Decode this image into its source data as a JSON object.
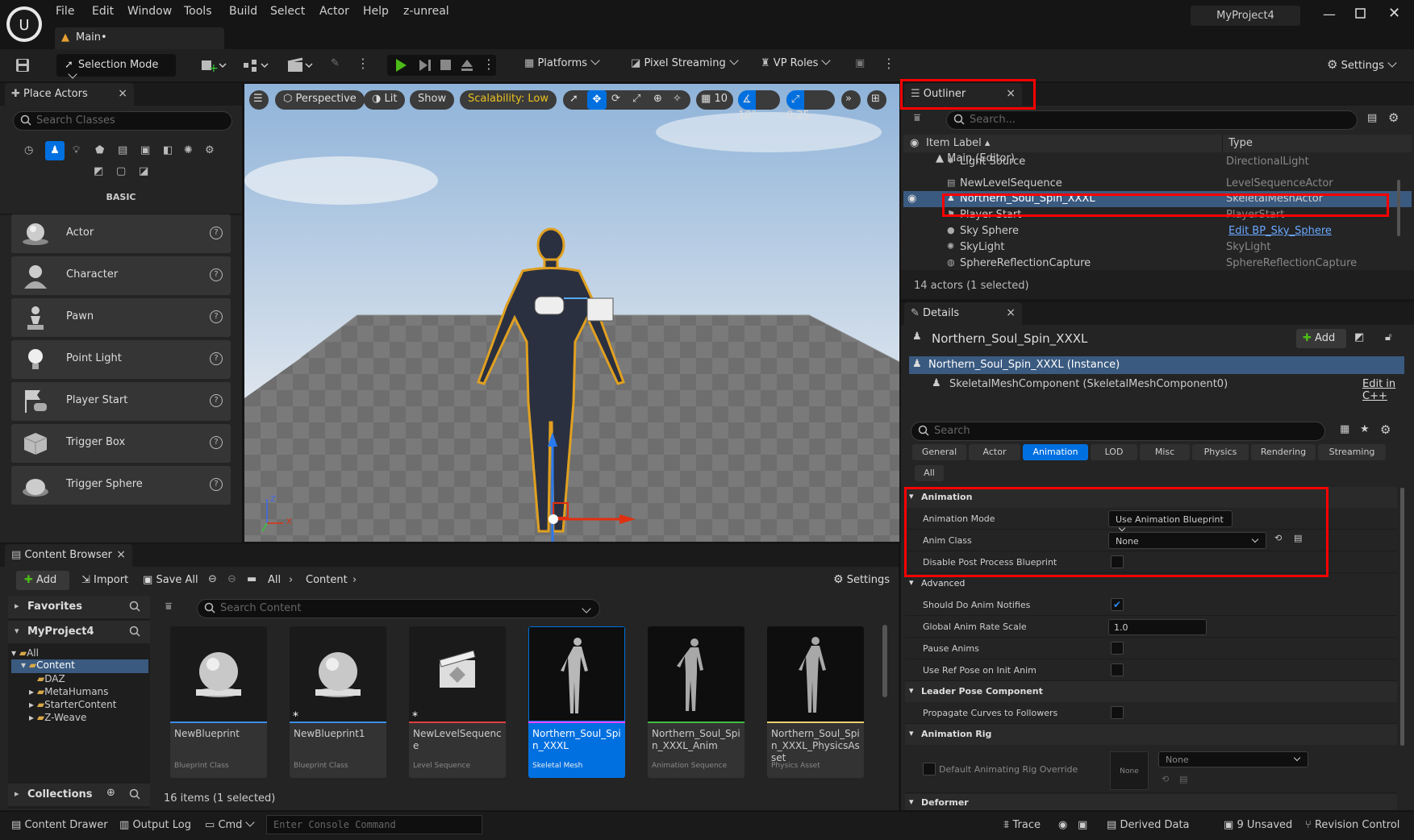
{
  "menu": [
    "File",
    "Edit",
    "Window",
    "Tools",
    "Build",
    "Select",
    "Actor",
    "Help",
    "z-unreal"
  ],
  "level_tab": "Main•",
  "project_name": "MyProject4",
  "toolbar": {
    "selection_mode": "Selection Mode",
    "platforms": "Platforms",
    "pixel_streaming": "Pixel Streaming",
    "vp_roles": "VP Roles",
    "settings": "Settings"
  },
  "place_actors": {
    "title": "Place Actors",
    "search_placeholder": "Search Classes",
    "category": "BASIC",
    "items": [
      "Actor",
      "Character",
      "Pawn",
      "Point Light",
      "Player Start",
      "Trigger Box",
      "Trigger Sphere"
    ]
  },
  "viewport": {
    "perspective": "Perspective",
    "lit": "Lit",
    "show": "Show",
    "scalability": "Scalability: Low",
    "grid": "10",
    "angle": "10°",
    "scale": "0.25",
    "axis_z": "Z",
    "axis_x": "X"
  },
  "outliner": {
    "title": "Outliner",
    "search_placeholder": "Search...",
    "col_label": "Item Label",
    "col_type": "Type",
    "root": "Main (Editor)",
    "rows": [
      {
        "name": "Light Source",
        "type": "DirectionalLight"
      },
      {
        "name": "NewLevelSequence",
        "type": "LevelSequenceActor"
      },
      {
        "name": "Northern_Soul_Spin_XXXL",
        "type": "SkeletalMeshActor"
      },
      {
        "name": "Player Start",
        "type": "PlayerStart"
      },
      {
        "name": "Sky Sphere",
        "type": "Edit BP_Sky_Sphere"
      },
      {
        "name": "SkyLight",
        "type": "SkyLight"
      },
      {
        "name": "SphereReflectionCapture",
        "type": "SphereReflectionCapture"
      }
    ],
    "status": "14 actors (1 selected)"
  },
  "details": {
    "title": "Details",
    "actor_name": "Northern_Soul_Spin_XXXL",
    "add": "Add",
    "instance": "Northern_Soul_Spin_XXXL (Instance)",
    "component": "SkeletalMeshComponent (SkeletalMeshComponent0)",
    "edit_cpp": "Edit in C++",
    "search_placeholder": "Search",
    "tabs": [
      "General",
      "Actor",
      "Animation",
      "LOD",
      "Misc",
      "Physics",
      "Rendering",
      "Streaming",
      "All"
    ],
    "sec_animation": "Animation",
    "anim_mode_label": "Animation Mode",
    "anim_mode_value": "Use Animation Blueprint",
    "anim_class_label": "Anim Class",
    "anim_class_value": "None",
    "disable_pp_label": "Disable Post Process Blueprint",
    "sec_advanced": "Advanced",
    "anim_notifies_label": "Should Do Anim Notifies",
    "rate_scale_label": "Global Anim Rate Scale",
    "rate_scale_value": "1.0",
    "pause_label": "Pause Anims",
    "ref_pose_label": "Use Ref Pose on Init Anim",
    "sec_leader": "Leader Pose Component",
    "propagate_label": "Propagate Curves to Followers",
    "sec_rig": "Animation Rig",
    "rig_override_label": "Default Animating Rig Override",
    "rig_thumb": "None",
    "rig_value": "None",
    "sec_deformer": "Deformer"
  },
  "content_browser": {
    "title": "Content Browser",
    "add": "Add",
    "import": "Import",
    "save_all": "Save All",
    "crumb_all": "All",
    "crumb_content": "Content",
    "settings": "Settings",
    "favorites": "Favorites",
    "project": "MyProject4",
    "search_placeholder": "Search Content",
    "tree": [
      "All",
      "Content",
      "DAZ",
      "MetaHumans",
      "StarterContent",
      "Z-Weave"
    ],
    "collections": "Collections",
    "status": "16 items (1 selected)",
    "assets": [
      {
        "name": "NewBlueprint",
        "type": "Blueprint Class"
      },
      {
        "name": "NewBlueprint1",
        "type": "Blueprint Class"
      },
      {
        "name": "NewLevelSequence",
        "type": "Level Sequence"
      },
      {
        "name": "Northern_Soul_Spin_XXXL",
        "type": "Skeletal Mesh"
      },
      {
        "name": "Northern_Soul_Spin_XXXL_Anim",
        "type": "Animation Sequence"
      },
      {
        "name": "Northern_Soul_Spin_XXXL_PhysicsAsset",
        "type": "Physics Asset"
      }
    ]
  },
  "statusbar": {
    "content_drawer": "Content Drawer",
    "output_log": "Output Log",
    "cmd": "Cmd",
    "console_placeholder": "Enter Console Command",
    "trace": "Trace",
    "derived_data": "Derived Data",
    "unsaved": "9 Unsaved",
    "revision": "Revision Control"
  },
  "colors": {
    "accent": "#0070e0",
    "selection": "#3a5a80",
    "highlight_box": "#ff0000"
  }
}
